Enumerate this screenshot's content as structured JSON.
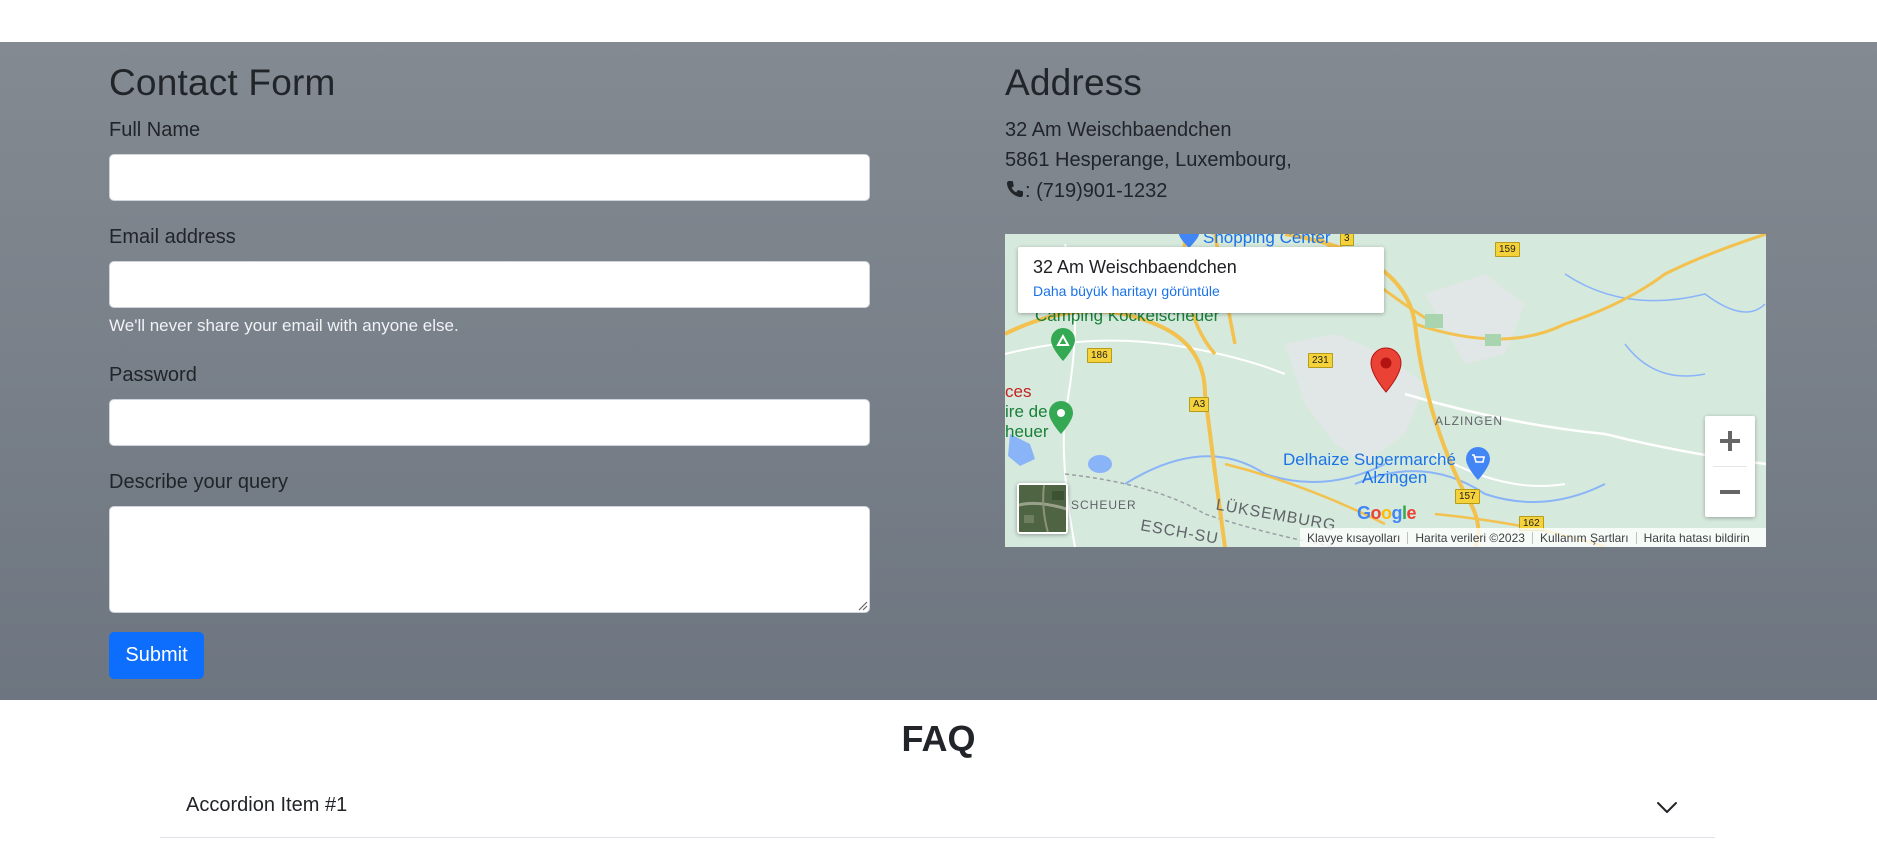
{
  "contact": {
    "title": "Contact Form",
    "full_name_label": "Full Name",
    "full_name_value": "",
    "email_label": "Email address",
    "email_value": "",
    "email_help": "We'll never share your email with anyone else.",
    "password_label": "Password",
    "password_value": "",
    "query_label": "Describe your query",
    "query_value": "",
    "submit_label": "Submit"
  },
  "address": {
    "title": "Address",
    "line1": "32 Am Weischbaendchen",
    "line2": "5861 Hesperange, Luxembourg,",
    "phone": ": (719)901-1232"
  },
  "map": {
    "place_title": "32 Am Weischbaendchen",
    "view_larger_link": "Daha büyük haritayı görüntüle",
    "labels": {
      "shopping_center": "Shopping Center",
      "camping": "Camping Kockelscheuer",
      "alzingen": "ALZINGEN",
      "delhaize_1": "Delhaize Supermarché",
      "delhaize_2": "Alzingen",
      "scheuer": "SCHEUER",
      "luksemburg": "LÜKSEMBURG",
      "esch": "ESCH-SU",
      "ces": "ces",
      "ire_de": "ire de",
      "heuer": "heuer"
    },
    "routes": [
      "159",
      "186",
      "231",
      "A3",
      "157",
      "162",
      "3"
    ],
    "footer": {
      "shortcuts": "Klavye kısayolları",
      "map_data": "Harita verileri ©2023",
      "terms": "Kullanım Şartları",
      "report": "Harita hatası bildirin"
    },
    "logo": "Google",
    "colors": {
      "land": "#d6e9dd",
      "road_major": "#f2c14e",
      "water": "#8ab4f8",
      "pin": "#ea4335",
      "poi_green": "#34a853",
      "poi_blue": "#4285f4"
    }
  },
  "faq": {
    "title": "FAQ",
    "items": [
      {
        "label": "Accordion Item #1"
      }
    ]
  },
  "colors": {
    "primary": "#0d6efd",
    "section_bg": "#7a818a"
  }
}
